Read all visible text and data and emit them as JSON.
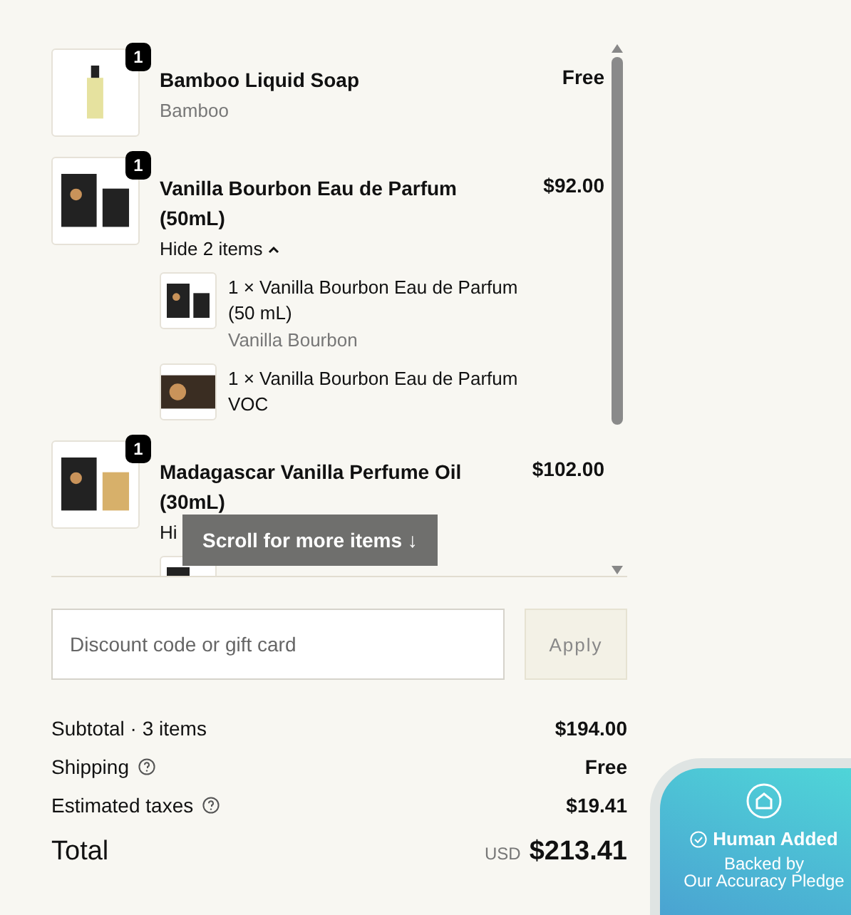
{
  "items": [
    {
      "quantity": "1",
      "name": "Bamboo Liquid Soap",
      "variant": "Bamboo",
      "price": "Free",
      "kind": "bottle"
    },
    {
      "quantity": "1",
      "name": "Vanilla Bourbon Eau de Parfum (50mL)",
      "price": "$92.00",
      "kind": "set",
      "toggle": "Hide 2 items",
      "expanded": true,
      "components": [
        {
          "text": "1 × Vanilla Bourbon Eau de Parfum (50 mL)",
          "variant": "Vanilla Bourbon",
          "kind": "set"
        },
        {
          "text": "1 × Vanilla Bourbon Eau de Parfum VOC",
          "kind": "card"
        }
      ]
    },
    {
      "quantity": "1",
      "name": "Madagascar Vanilla Perfume Oil (30mL)",
      "price": "$102.00",
      "kind": "oil",
      "toggle": "Hi",
      "components": [
        {
          "kind": "oil"
        }
      ]
    }
  ],
  "scroll_hint": "Scroll for more items ↓",
  "discount": {
    "placeholder": "Discount code or gift card",
    "button": "Apply",
    "disabled": true
  },
  "summary": [
    {
      "label": "Subtotal · 3 items",
      "value": "$194.00",
      "help": false
    },
    {
      "label": "Shipping",
      "value": "Free",
      "help": true
    },
    {
      "label": "Estimated taxes",
      "value": "$19.41",
      "help": true
    }
  ],
  "total": {
    "label": "Total",
    "currency": "USD",
    "value": "$213.41"
  },
  "badge": {
    "title": "Human Added",
    "subtitle": "Backed by\nOur Accuracy Pledge"
  }
}
